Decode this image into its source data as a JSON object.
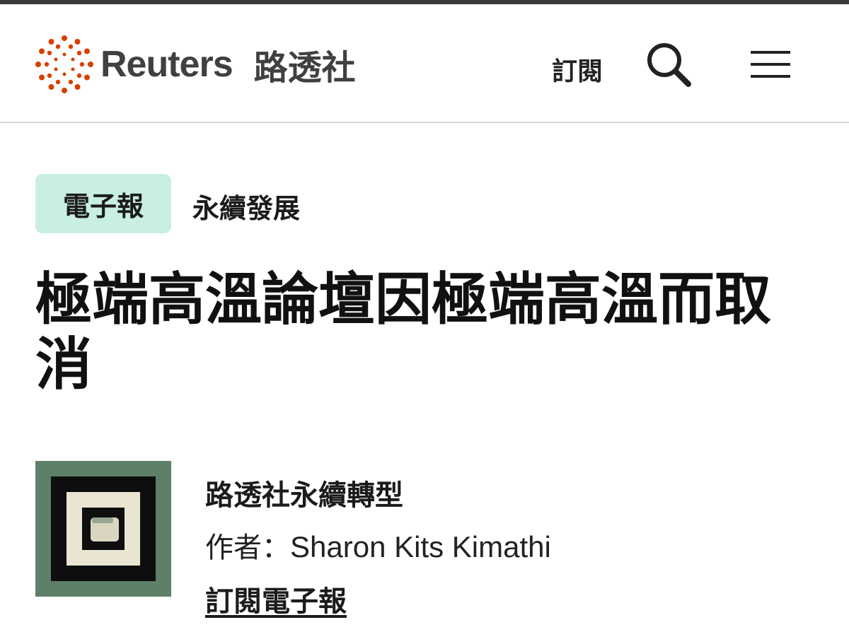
{
  "header": {
    "brand_name": "Reuters",
    "brand_name_cn": "路透社",
    "subscribe_label": "訂閱",
    "search_icon": "search-icon",
    "menu_icon": "hamburger-menu-icon",
    "brand_color": "#D64000"
  },
  "tags": {
    "badge_label": "電子報",
    "badge_color": "#C9EFE1",
    "section_label": "永續發展"
  },
  "article": {
    "headline": "極端高溫論壇因極端高溫而取消"
  },
  "newsletter": {
    "thumbnail_icon": "newsletter-logo-icon",
    "name": "路透社永續轉型",
    "byline_prefix": "作者：",
    "author": "Sharon Kits Kimathi",
    "subscribe_link": "訂閱電子報"
  }
}
